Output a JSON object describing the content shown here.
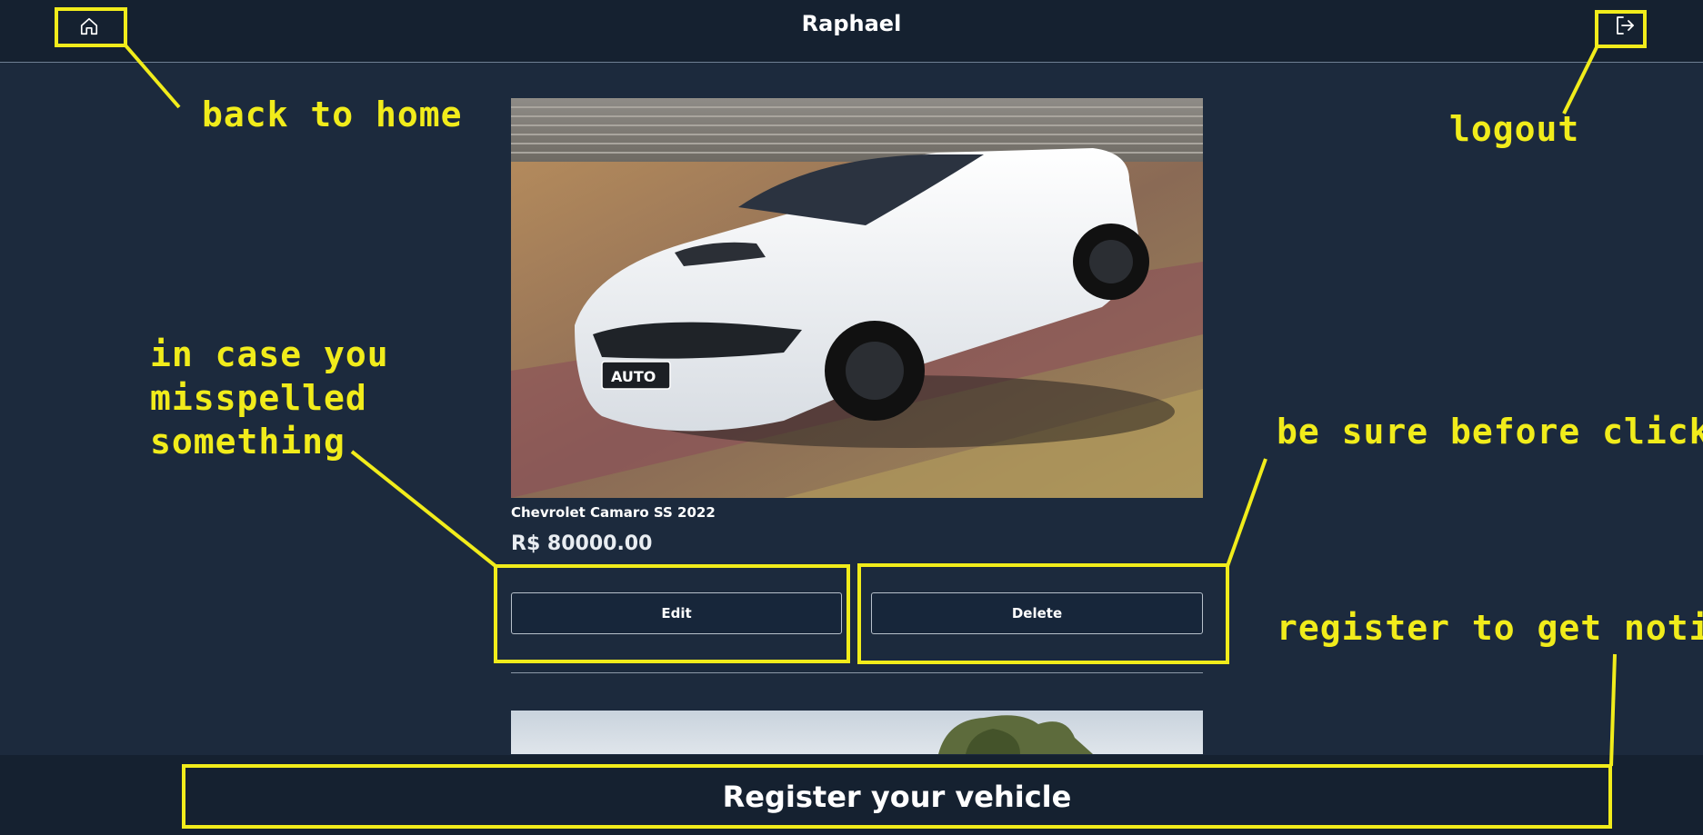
{
  "header": {
    "title": "Raphael",
    "home_icon": "home-icon",
    "logout_icon": "logout-icon"
  },
  "listing": {
    "name": "Chevrolet Camaro SS 2022",
    "price": "R$ 80000.00",
    "plate_text": "AUTO",
    "edit_label": "Edit",
    "delete_label": "Delete"
  },
  "footer": {
    "register_label": "Register your vehicle"
  },
  "annotations": {
    "home": "back to home",
    "logout": "logout",
    "edit_line1": "in case you",
    "edit_line2": "misspelled",
    "edit_line3": "something",
    "delete": "be sure before click it",
    "register": "register to get noticed"
  },
  "colors": {
    "background": "#1c2a3d",
    "topbar": "#152130",
    "annotation": "#f1ec1b"
  }
}
